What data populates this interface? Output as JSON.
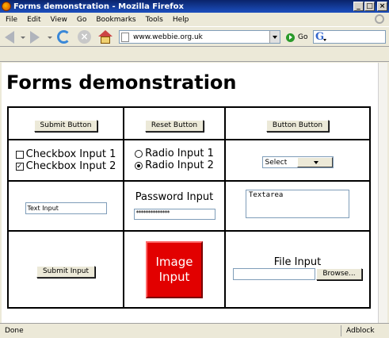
{
  "window": {
    "title": "Forms demonstration - Mozilla Firefox"
  },
  "menu": [
    "File",
    "Edit",
    "View",
    "Go",
    "Bookmarks",
    "Tools",
    "Help"
  ],
  "navigation": {
    "url": "www.webbie.org.uk",
    "go_label": "Go",
    "search_logo": "G"
  },
  "page": {
    "title": "Forms demonstration",
    "row1": {
      "submit_button": "Submit Button",
      "reset_button": "Reset Button",
      "plain_button": "Button Button"
    },
    "row2": {
      "checkboxes": [
        {
          "label": "Checkbox Input 1",
          "checked": false
        },
        {
          "label": "Checkbox Input 2",
          "checked": true
        }
      ],
      "radios": [
        {
          "label": "Radio Input 1",
          "selected": false
        },
        {
          "label": "Radio Input 2",
          "selected": true
        }
      ],
      "select_value": "Select"
    },
    "row3": {
      "text_input_value": "Text Input",
      "password_label": "Password Input",
      "password_mask": "**************",
      "textarea_value": "Textarea"
    },
    "row4": {
      "submit_input": "Submit Input",
      "image_input_line1": "Image",
      "image_input_line2": "Input",
      "file_label": "File Input",
      "browse_button": "Browse..."
    }
  },
  "status": {
    "text": "Done",
    "adblock": "Adblock"
  },
  "colors": {
    "titlebar": "#0a246a",
    "image_input": "#e20000",
    "chrome": "#ece9d8"
  }
}
